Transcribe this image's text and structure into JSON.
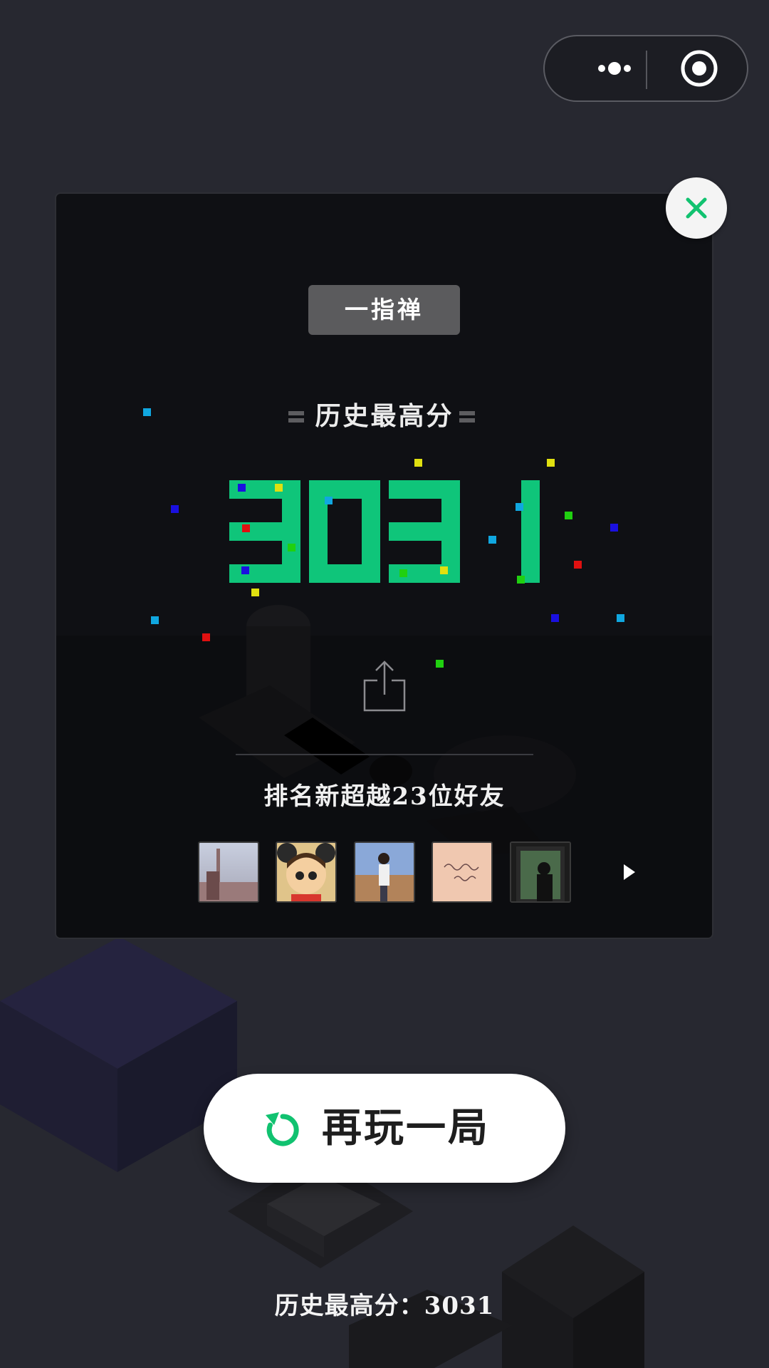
{
  "game": {
    "title": "一指禅",
    "best_label": "历史最高分",
    "score": "3031",
    "score_color": "#0fc57a",
    "rank_text": "排名新超越23位好友"
  },
  "friends": [
    {
      "name": "avatar-tower-photo"
    },
    {
      "name": "avatar-cartoon-boy"
    },
    {
      "name": "avatar-girl-desert"
    },
    {
      "name": "avatar-handwriting"
    },
    {
      "name": "avatar-silhouette-window"
    }
  ],
  "actions": {
    "replay_label": "再玩一局",
    "accent": "#11c270"
  },
  "footer": {
    "best_score_text": "历史最高分：3031"
  },
  "icons": {
    "more": "more-dots-icon",
    "target": "target-icon",
    "close": "close-icon",
    "share": "share-icon",
    "next": "play-next-icon",
    "replay": "replay-icon"
  }
}
